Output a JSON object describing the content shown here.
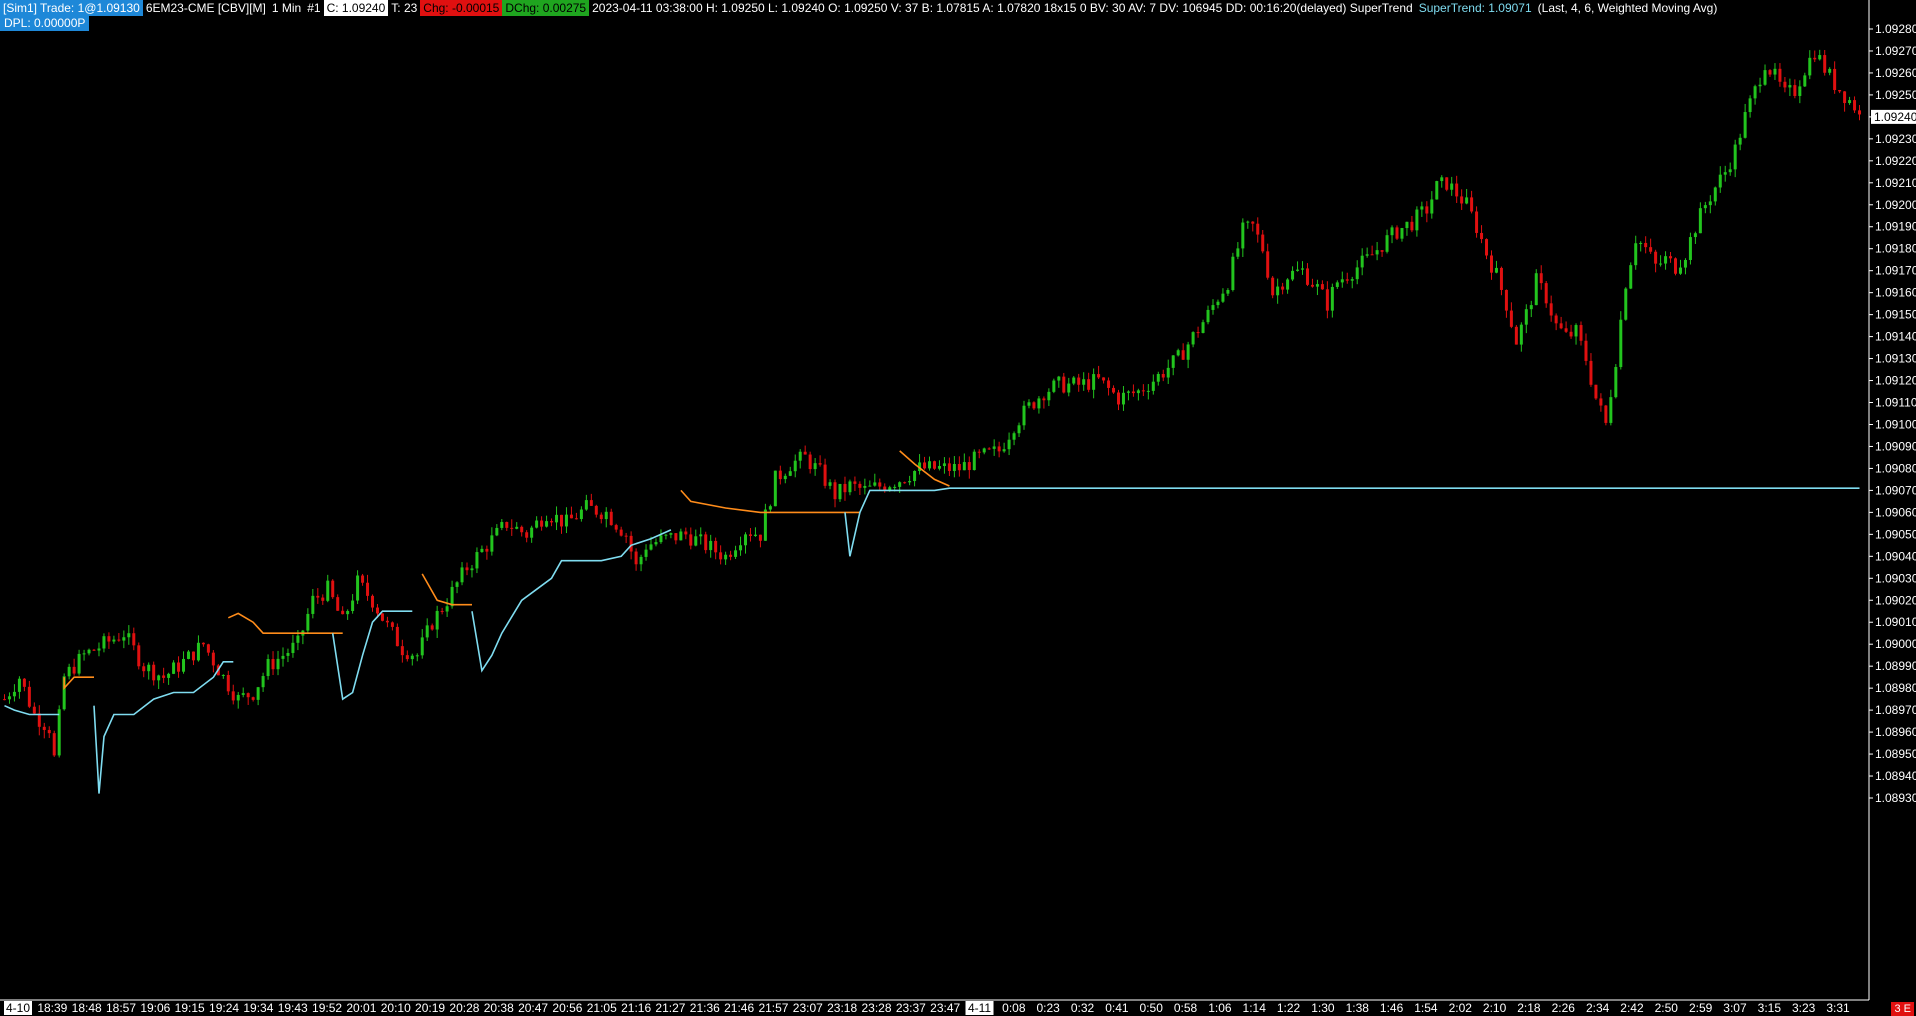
{
  "header": {
    "sim": "[Sim1]",
    "trade": "Trade: 1@1.09130",
    "symbol": "6EM23-CME [CBV][M]",
    "interval": "1 Min",
    "chart_no": "#1",
    "close": "C: 1.09240",
    "ticks": "T: 23",
    "chg": "Chg: -0.00015",
    "dchg": "DChg: 0.00275",
    "info": "2023-04-11 03:38:00 H: 1.09250 L: 1.09240 O: 1.09250 V: 37 B: 1.07815 A: 1.07820 18x15 0 BV: 30 AV: 7 DV: 106945 DD: 00:16:20(delayed) SuperTrend",
    "supertrend_label": "SuperTrend: 1.09071",
    "supertrend_params": "(Last, 4, 6, Weighted Moving Avg)",
    "dpl": "DPL: 0.00000P"
  },
  "colors": {
    "up": "#22c41e",
    "down": "#e01010",
    "st_up": "#7fdcf0",
    "st_down": "#ff8c1a",
    "axis": "#ffffff",
    "sim_bg": "#1e88d8",
    "chg_bg": "#e01010",
    "dchg_bg": "#1fa51f"
  },
  "badge": "3 E",
  "chart_data": {
    "type": "ohlc",
    "price_labels": [
      "1.09280",
      "1.09270",
      "1.09260",
      "1.09250",
      "1.09240",
      "1.09230",
      "1.09220",
      "1.09210",
      "1.09200",
      "1.09190",
      "1.09180",
      "1.09170",
      "1.09160",
      "1.09150",
      "1.09140",
      "1.09130",
      "1.09120",
      "1.09110",
      "1.09100",
      "1.09090",
      "1.09080",
      "1.09070",
      "1.09060",
      "1.09050",
      "1.09040",
      "1.09030",
      "1.09020",
      "1.09010",
      "1.09000",
      "1.08990",
      "1.08980",
      "1.08970",
      "1.08960",
      "1.08950",
      "1.08940",
      "1.08930"
    ],
    "current_price_label": "1.09240",
    "ylim": [
      1.08925,
      1.09285
    ],
    "time_labels": [
      "4-10",
      "18:39",
      "18:48",
      "18:57",
      "19:06",
      "19:15",
      "19:24",
      "19:34",
      "19:43",
      "19:52",
      "20:01",
      "20:10",
      "20:19",
      "20:28",
      "20:38",
      "20:47",
      "20:56",
      "21:05",
      "21:16",
      "21:27",
      "21:36",
      "21:46",
      "21:57",
      "23:07",
      "23:18",
      "23:28",
      "23:37",
      "23:47",
      "4-11",
      "0:08",
      "0:23",
      "0:32",
      "0:41",
      "0:50",
      "0:58",
      "1:06",
      "1:14",
      "1:22",
      "1:30",
      "1:38",
      "1:46",
      "1:54",
      "2:02",
      "2:10",
      "2:18",
      "2:26",
      "2:34",
      "2:42",
      "2:50",
      "2:59",
      "3:07",
      "3:15",
      "3:23",
      "3:31"
    ],
    "highlighted_time_labels": [
      "4-10",
      "4-11"
    ],
    "price_path": [
      [
        0,
        1.08975
      ],
      [
        3,
        1.08985
      ],
      [
        6,
        1.08968
      ],
      [
        9,
        1.08962
      ],
      [
        10,
        1.08948
      ],
      [
        12,
        1.08985
      ],
      [
        16,
        1.08995
      ],
      [
        20,
        1.09
      ],
      [
        24,
        1.09005
      ],
      [
        28,
        1.0899
      ],
      [
        32,
        1.08985
      ],
      [
        36,
        1.08992
      ],
      [
        40,
        1.09
      ],
      [
        44,
        1.08985
      ],
      [
        47,
        1.08975
      ],
      [
        50,
        1.08978
      ],
      [
        53,
        1.0899
      ],
      [
        56,
        1.08995
      ],
      [
        59,
        1.09
      ],
      [
        62,
        1.0902
      ],
      [
        65,
        1.09025
      ],
      [
        68,
        1.0901
      ],
      [
        71,
        1.09028
      ],
      [
        74,
        1.0902
      ],
      [
        77,
        1.09008
      ],
      [
        80,
        1.08998
      ],
      [
        83,
        1.08995
      ],
      [
        86,
        1.0901
      ],
      [
        89,
        1.0902
      ],
      [
        93,
        1.09035
      ],
      [
        97,
        1.09045
      ],
      [
        101,
        1.09055
      ],
      [
        105,
        1.0905
      ],
      [
        109,
        1.0906
      ],
      [
        113,
        1.09055
      ],
      [
        117,
        1.09062
      ],
      [
        121,
        1.0906
      ],
      [
        125,
        1.0905
      ],
      [
        127,
        1.09035
      ],
      [
        129,
        1.09045
      ],
      [
        133,
        1.09048
      ],
      [
        137,
        1.0905
      ],
      [
        141,
        1.09045
      ],
      [
        145,
        1.0904
      ],
      [
        149,
        1.09052
      ],
      [
        152,
        1.0905
      ],
      [
        155,
        1.09075
      ],
      [
        158,
        1.09082
      ],
      [
        161,
        1.09085
      ],
      [
        164,
        1.09078
      ],
      [
        167,
        1.09068
      ],
      [
        170,
        1.09072
      ],
      [
        173,
        1.0907
      ],
      [
        176,
        1.09072
      ],
      [
        180,
        1.09075
      ],
      [
        184,
        1.0908
      ],
      [
        188,
        1.0908
      ],
      [
        192,
        1.0908
      ],
      [
        196,
        1.09085
      ],
      [
        200,
        1.09088
      ],
      [
        203,
        1.091
      ],
      [
        206,
        1.09108
      ],
      [
        209,
        1.09115
      ],
      [
        212,
        1.09118
      ],
      [
        216,
        1.09118
      ],
      [
        220,
        1.0912
      ],
      [
        224,
        1.09112
      ],
      [
        228,
        1.09115
      ],
      [
        232,
        1.09122
      ],
      [
        236,
        1.0913
      ],
      [
        239,
        1.0914
      ],
      [
        242,
        1.0915
      ],
      [
        244,
        1.09158
      ],
      [
        246,
        1.09165
      ],
      [
        249,
        1.09188
      ],
      [
        251,
        1.0919
      ],
      [
        253,
        1.0918
      ],
      [
        255,
        1.0916
      ],
      [
        258,
        1.09168
      ],
      [
        261,
        1.0917
      ],
      [
        264,
        1.09162
      ],
      [
        266,
        1.09155
      ],
      [
        268,
        1.09165
      ],
      [
        271,
        1.0917
      ],
      [
        274,
        1.09175
      ],
      [
        277,
        1.09182
      ],
      [
        280,
        1.09188
      ],
      [
        283,
        1.09192
      ],
      [
        286,
        1.09198
      ],
      [
        288,
        1.09208
      ],
      [
        290,
        1.0921
      ],
      [
        292,
        1.09205
      ],
      [
        294,
        1.092
      ],
      [
        296,
        1.0919
      ],
      [
        298,
        1.09178
      ],
      [
        300,
        1.09168
      ],
      [
        302,
        1.09155
      ],
      [
        304,
        1.09138
      ],
      [
        306,
        1.0915
      ],
      [
        308,
        1.09165
      ],
      [
        310,
        1.09158
      ],
      [
        312,
        1.09145
      ],
      [
        314,
        1.0914
      ],
      [
        316,
        1.09142
      ],
      [
        318,
        1.0913
      ],
      [
        320,
        1.09112
      ],
      [
        322,
        1.091
      ],
      [
        324,
        1.0913
      ],
      [
        326,
        1.09165
      ],
      [
        328,
        1.09185
      ],
      [
        330,
        1.0918
      ],
      [
        332,
        1.09172
      ],
      [
        334,
        1.09175
      ],
      [
        336,
        1.09172
      ],
      [
        338,
        1.09178
      ],
      [
        340,
        1.0919
      ],
      [
        342,
        1.092
      ],
      [
        344,
        1.09208
      ],
      [
        346,
        1.09215
      ],
      [
        348,
        1.09225
      ],
      [
        350,
        1.0924
      ],
      [
        352,
        1.09252
      ],
      [
        354,
        1.09265
      ],
      [
        356,
        1.09258
      ],
      [
        358,
        1.0925
      ],
      [
        360,
        1.09252
      ],
      [
        362,
        1.09262
      ],
      [
        364,
        1.0927
      ],
      [
        366,
        1.09262
      ],
      [
        368,
        1.09255
      ],
      [
        370,
        1.0925
      ],
      [
        372,
        1.09245
      ],
      [
        373,
        1.0924
      ]
    ],
    "supertrend_orange": [
      [
        [
          12,
          1.08985
        ],
        [
          12,
          1.0898
        ],
        [
          14,
          1.08985
        ],
        [
          18,
          1.08985
        ]
      ],
      [
        [
          45,
          1.09012
        ],
        [
          47,
          1.09014
        ],
        [
          50,
          1.0901
        ],
        [
          52,
          1.09005
        ],
        [
          60,
          1.09005
        ],
        [
          68,
          1.09005
        ]
      ],
      [
        [
          84,
          1.09032
        ],
        [
          87,
          1.0902
        ],
        [
          90,
          1.09018
        ],
        [
          94,
          1.09018
        ]
      ],
      [
        [
          136,
          1.0907
        ],
        [
          138,
          1.09065
        ],
        [
          145,
          1.09062
        ],
        [
          152,
          1.0906
        ],
        [
          165,
          1.0906
        ],
        [
          172,
          1.0906
        ]
      ],
      [
        [
          180,
          1.09088
        ],
        [
          183,
          1.09082
        ],
        [
          187,
          1.09075
        ],
        [
          190,
          1.09072
        ]
      ]
    ],
    "supertrend_cyan": [
      [
        [
          0,
          1.08972
        ],
        [
          2,
          1.0897
        ],
        [
          5,
          1.08968
        ],
        [
          11,
          1.08968
        ]
      ],
      [
        [
          18,
          1.08972
        ],
        [
          19,
          1.08932
        ],
        [
          20,
          1.08958
        ],
        [
          22,
          1.08968
        ],
        [
          26,
          1.08968
        ],
        [
          30,
          1.08975
        ],
        [
          34,
          1.08978
        ],
        [
          38,
          1.08978
        ],
        [
          42,
          1.08985
        ],
        [
          44,
          1.08992
        ],
        [
          46,
          1.08992
        ]
      ],
      [
        [
          66,
          1.09005
        ],
        [
          68,
          1.08975
        ],
        [
          70,
          1.08978
        ],
        [
          72,
          1.08995
        ],
        [
          74,
          1.0901
        ],
        [
          76,
          1.09015
        ],
        [
          82,
          1.09015
        ]
      ],
      [
        [
          94,
          1.09015
        ],
        [
          96,
          1.08988
        ],
        [
          98,
          1.08995
        ],
        [
          100,
          1.09005
        ],
        [
          104,
          1.0902
        ],
        [
          107,
          1.09025
        ],
        [
          110,
          1.0903
        ],
        [
          112,
          1.09038
        ],
        [
          114,
          1.09038
        ],
        [
          120,
          1.09038
        ],
        [
          124,
          1.0904
        ],
        [
          126,
          1.09045
        ],
        [
          130,
          1.09048
        ],
        [
          134,
          1.09052
        ]
      ],
      [
        [
          169,
          1.0906
        ],
        [
          170,
          1.0904
        ],
        [
          172,
          1.0906
        ],
        [
          174,
          1.0907
        ],
        [
          178,
          1.0907
        ],
        [
          184,
          1.0907
        ],
        [
          187,
          1.0907
        ],
        [
          190,
          1.09071
        ],
        [
          373,
          1.09071
        ]
      ]
    ]
  }
}
